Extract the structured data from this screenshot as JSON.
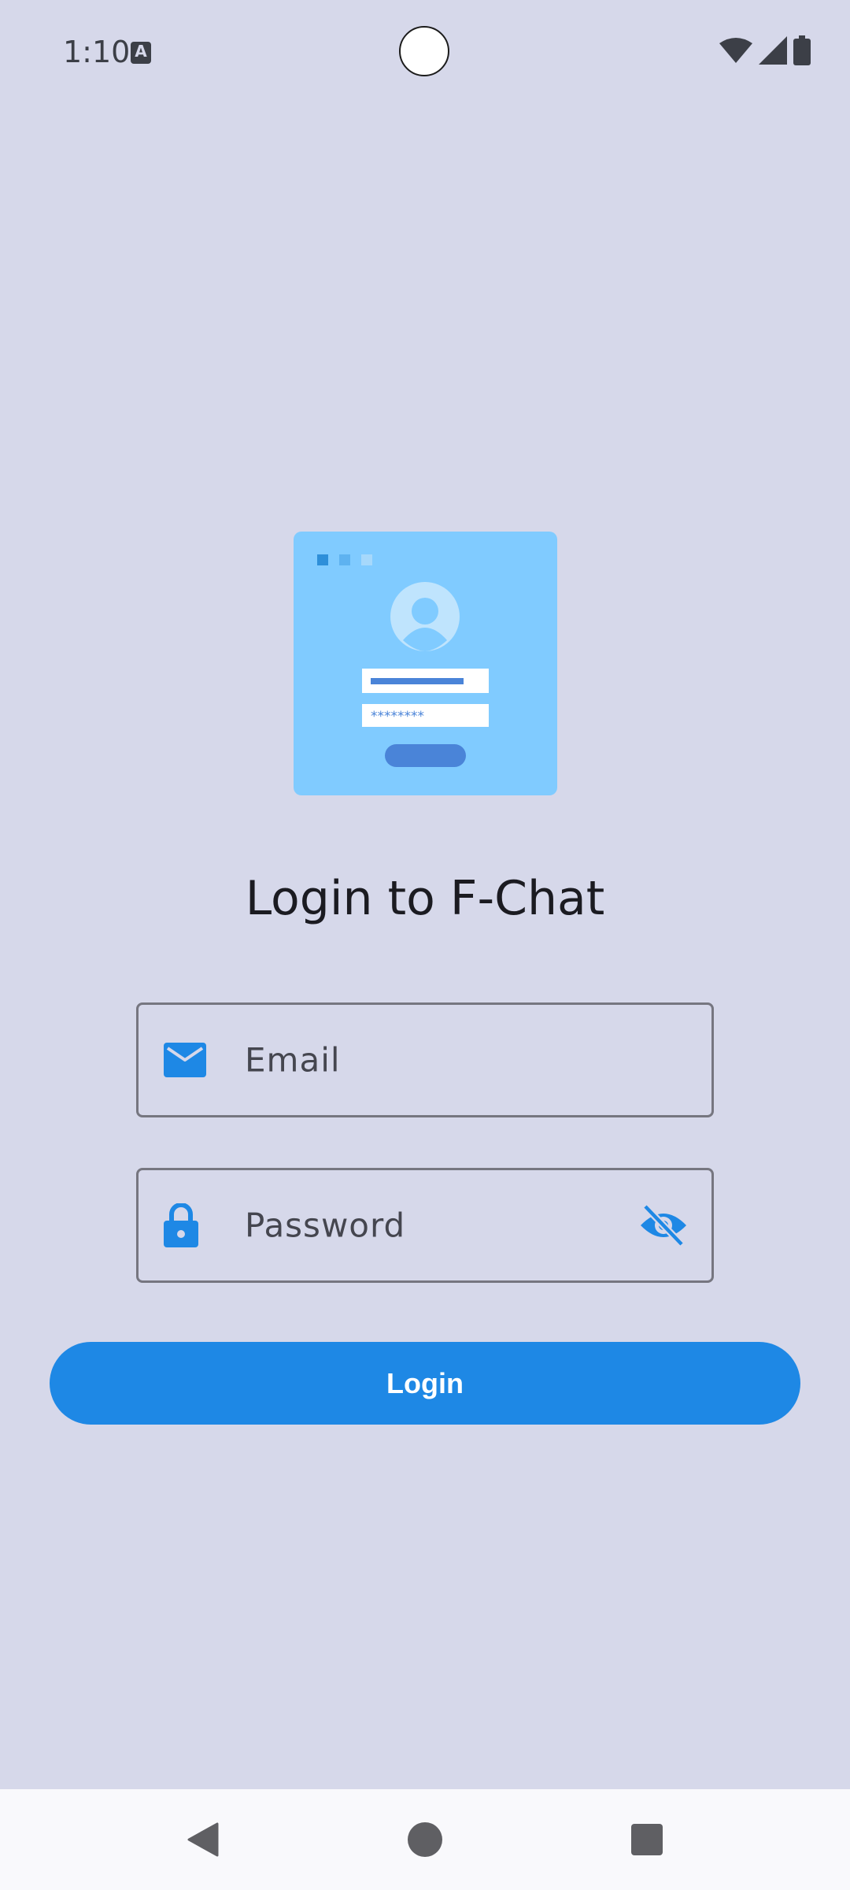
{
  "status_bar": {
    "time": "1:10",
    "notification_icon_letter": "A",
    "icons": [
      "wifi-icon",
      "signal-icon",
      "battery-icon"
    ]
  },
  "illustration": {
    "icon": "login-card-illustration",
    "password_mask": "********"
  },
  "title": "Login to F-Chat",
  "email_field": {
    "placeholder": "Email",
    "icon": "email-icon"
  },
  "password_field": {
    "placeholder": "Password",
    "icon": "lock-icon",
    "trailing_icon": "visibility-off-icon"
  },
  "login_button": {
    "label": "Login"
  },
  "nav_bar": {
    "buttons": [
      "back-icon",
      "home-icon",
      "recents-icon"
    ]
  },
  "colors": {
    "background": "#d6d8ea",
    "accent": "#1e88e5",
    "illustration_bg": "#80cbff",
    "text_primary": "#1b1b21",
    "outline": "#767680"
  }
}
